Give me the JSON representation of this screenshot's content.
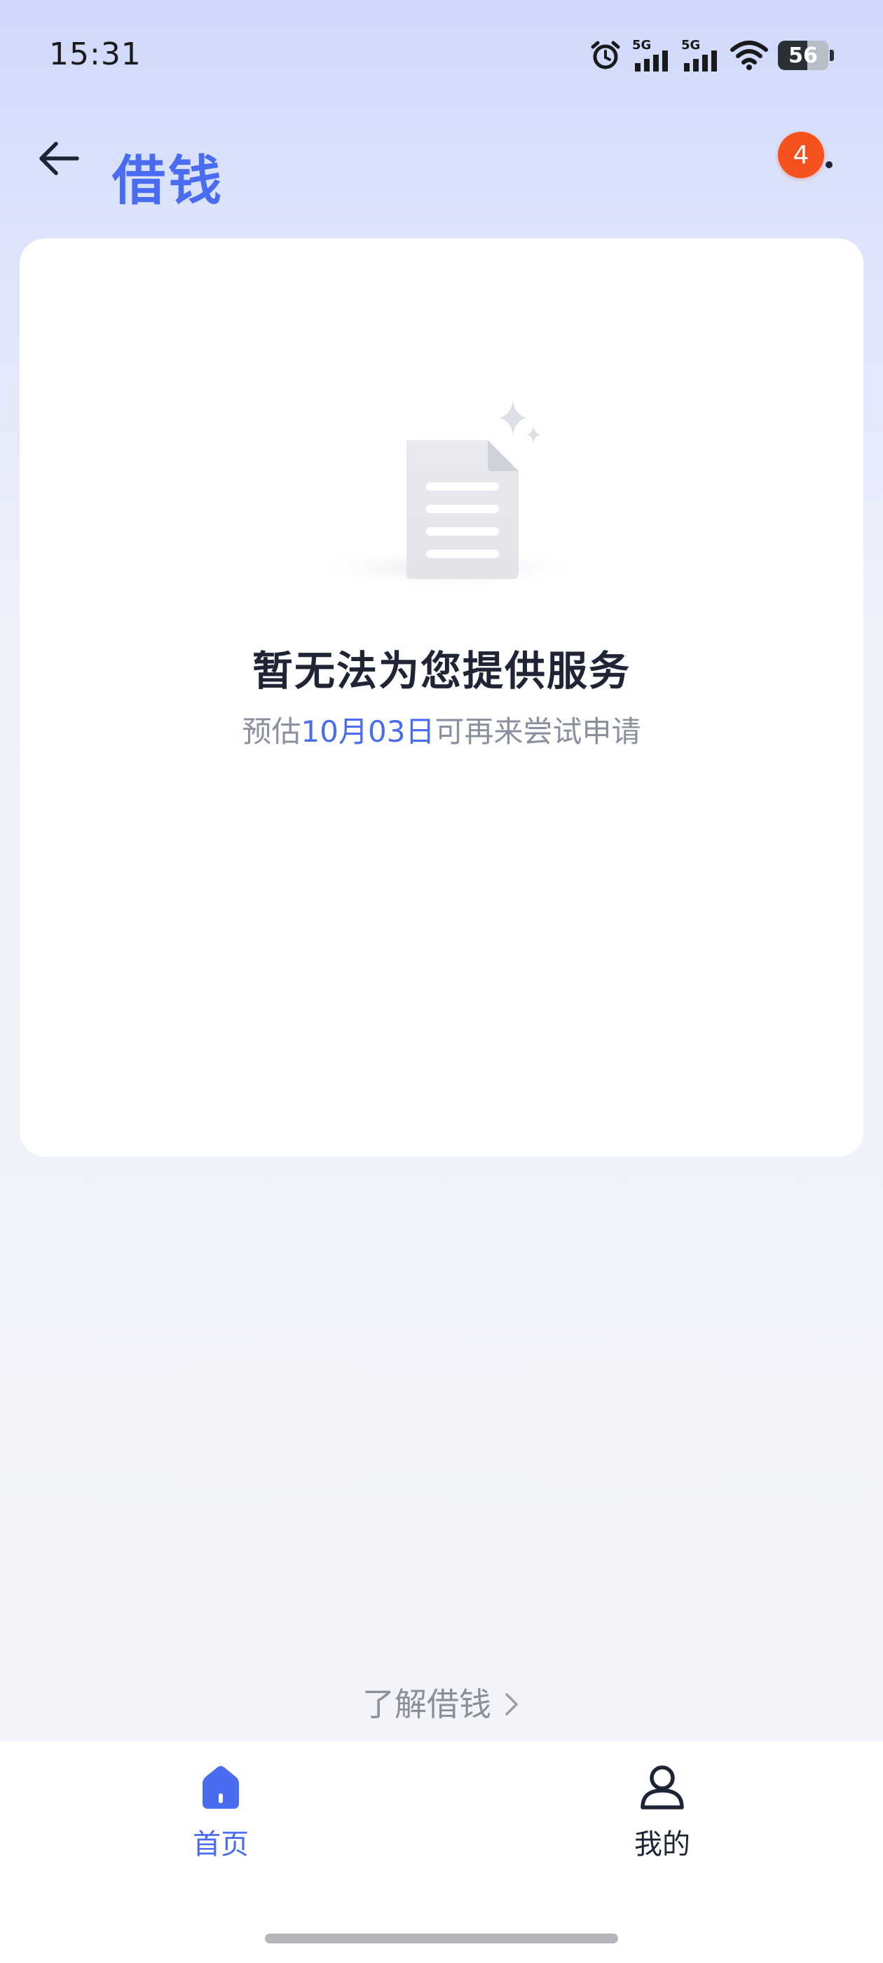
{
  "status_bar": {
    "time": "15:31",
    "network_1": "5G",
    "network_2": "5G",
    "battery": "56",
    "icons": [
      "alarm-icon",
      "signal-icon",
      "signal-icon",
      "wifi-icon",
      "battery-icon"
    ]
  },
  "header": {
    "title": "借钱",
    "notification_count": "4",
    "icons": [
      "back-arrow-icon",
      "more-dots-icon"
    ]
  },
  "card": {
    "illustration": "empty-document-icon",
    "title": "暂无法为您提供服务",
    "subtitle_prefix": "预估",
    "subtitle_date": "10月03日",
    "subtitle_suffix": "可再来尝试申请"
  },
  "learn_more": {
    "label": "了解借钱",
    "icon": "chevron-right-icon"
  },
  "bottom_nav": {
    "items": [
      {
        "label": "首页",
        "icon": "home-icon",
        "active": true
      },
      {
        "label": "我的",
        "icon": "user-icon",
        "active": false
      }
    ]
  },
  "colors": {
    "accent": "#4a6cf0",
    "badge": "#f5511e",
    "muted_text": "#8a909e"
  }
}
